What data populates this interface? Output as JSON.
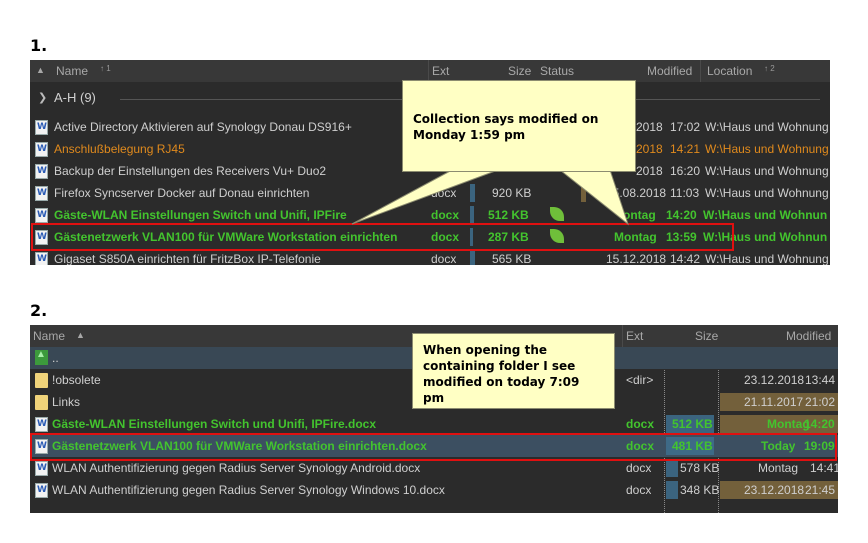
{
  "labels": {
    "section1": "1.",
    "section2": "2."
  },
  "panel1": {
    "headers": {
      "name": "Name",
      "name_sort": "↑ 1",
      "ext": "Ext",
      "size": "Size",
      "status": "Status",
      "modified": "Modified",
      "location": "Location",
      "location_sort": "↑ 2"
    },
    "group": {
      "title": "A-H (9)"
    },
    "rows": [
      {
        "name": "Active Directory Aktivieren auf Synology Donau DS916+",
        "ext": "",
        "size": "",
        "date": "2018",
        "time": "17:02",
        "location": "W:\\Haus und Wohnung",
        "style": "normal"
      },
      {
        "name": "Anschlußbelegung RJ45",
        "ext": "",
        "size": "",
        "date": "2018",
        "time": "14:21",
        "location": "W:\\Haus und Wohnung",
        "style": "orange"
      },
      {
        "name": "Backup der Einstellungen des Receivers Vu+ Duo2",
        "ext": "",
        "size": "",
        "date": "2018",
        "time": "16:20",
        "location": "W:\\Haus und Wohnung",
        "style": "normal"
      },
      {
        "name": "Firefox Syncserver Docker auf Donau einrichten",
        "ext": "docx",
        "size": "920 KB",
        "date": "05.08.2018",
        "time": "11:03",
        "location": "W:\\Haus und Wohnung",
        "style": "normal"
      },
      {
        "name": "Gäste-WLAN Einstellungen Switch und Unifi, IPFire",
        "ext": "docx",
        "size": "512 KB",
        "date": "ontag",
        "time": "14:20",
        "location": "W:\\Haus und Wohnun",
        "style": "green"
      },
      {
        "name": "Gästenetzwerk VLAN100 für VMWare Workstation einrichten",
        "ext": "docx",
        "size": "287 KB",
        "date": "Montag",
        "time": "13:59",
        "location": "W:\\Haus und Wohnun",
        "style": "green"
      },
      {
        "name": "Gigaset S850A einrichten für FritzBox IP-Telefonie",
        "ext": "docx",
        "size": "565 KB",
        "date": "15.12.2018",
        "time": "14:42",
        "location": "W:\\Haus und Wohnung",
        "style": "normal"
      }
    ],
    "callout": {
      "line1": "Collection says modified on",
      "line2": "Monday 1:59 pm"
    }
  },
  "panel2": {
    "headers": {
      "name": "Name",
      "ext": "Ext",
      "size": "Size",
      "modified": "Modified"
    },
    "rows": [
      {
        "name": "..",
        "ext": "",
        "size": "",
        "date": "",
        "time": "",
        "kind": "up"
      },
      {
        "name": "!obsolete",
        "ext": "<dir>",
        "size": "",
        "date": "23.12.2018",
        "time": "13:44",
        "kind": "folder"
      },
      {
        "name": "Links",
        "ext": "",
        "size": "",
        "date": "21.11.2017",
        "time": "21:02",
        "kind": "folder"
      },
      {
        "name": "Gäste-WLAN Einstellungen Switch und Unifi, IPFire.docx",
        "ext": "docx",
        "size": "512 KB",
        "date": "Montag",
        "time": "14:20",
        "kind": "green"
      },
      {
        "name": "Gästenetzwerk VLAN100 für VMWare Workstation einrichten.docx",
        "ext": "docx",
        "size": "481 KB",
        "date": "Today",
        "time": "19:09",
        "kind": "green-sel"
      },
      {
        "name": "WLAN Authentifizierung gegen Radius Server Synology Android.docx",
        "ext": "docx",
        "size": "578 KB",
        "date": "Montag",
        "time": "14:41",
        "kind": "normal"
      },
      {
        "name": "WLAN Authentifizierung gegen Radius Server Synology Windows 10.docx",
        "ext": "docx",
        "size": "348 KB",
        "date": "23.12.2018",
        "time": "21:45",
        "kind": "normal"
      }
    ],
    "callout": {
      "line1": "When opening the",
      "line2": "containing folder I see",
      "line3": "modified on today 7:09 pm"
    }
  },
  "colors": {
    "green_text": "#43c42e",
    "orange_text": "#e08a1d",
    "highlight_box": "#e01010",
    "callout_bg": "#ffffc4",
    "panel_bg": "#2b2b2b"
  },
  "icons": {
    "doc": "word-document-icon",
    "folder": "folder-icon",
    "up": "parent-folder-icon",
    "status": "leaf-status-icon"
  }
}
